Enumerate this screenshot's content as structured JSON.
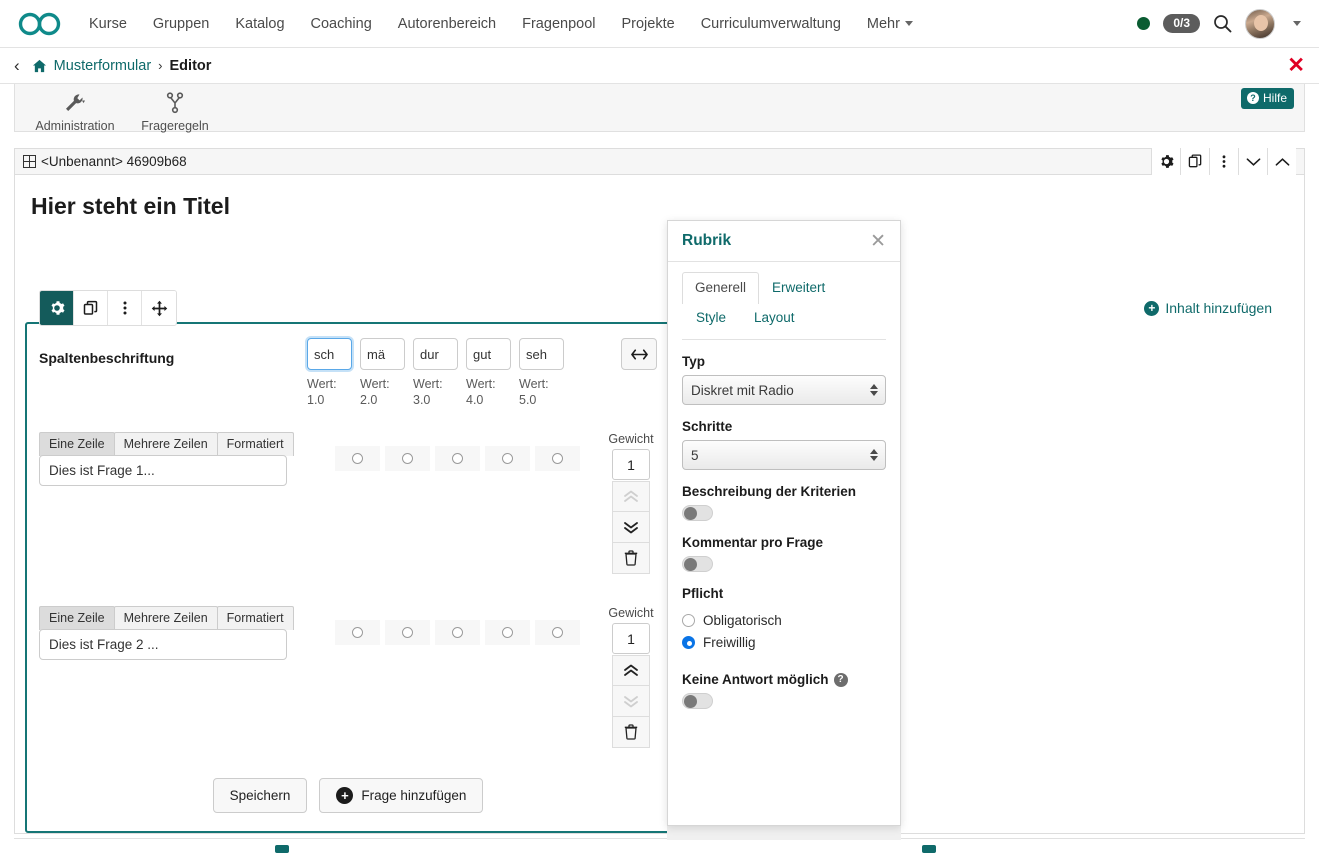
{
  "topnav": {
    "brand_icon": "infinity-logo",
    "links": [
      {
        "label": "Kurse"
      },
      {
        "label": "Gruppen"
      },
      {
        "label": "Katalog"
      },
      {
        "label": "Coaching"
      },
      {
        "label": "Autorenbereich"
      },
      {
        "label": "Fragenpool"
      },
      {
        "label": "Projekte"
      },
      {
        "label": "Curriculumverwaltung"
      },
      {
        "label": "Mehr"
      }
    ],
    "status_dot_color": "#0a5c32",
    "task_badge": "0/3",
    "search_icon": "search-icon",
    "avatar_caret": "chevron-down-icon"
  },
  "breadcrumb": {
    "back_icon": "chevron-left-icon",
    "home_icon": "home-icon",
    "root": "Musterformular",
    "separator": "›",
    "current": "Editor",
    "close": "✕"
  },
  "toolbar": {
    "items": [
      {
        "label": "Administration",
        "icon": "wrench-icon",
        "has_caret": true
      },
      {
        "label": "Frageregeln",
        "icon": "branch-icon",
        "has_caret": false
      }
    ],
    "help_label": "Hilfe",
    "help_icon": "question-circle-icon"
  },
  "block": {
    "header_title": "<Unbenannt> 46909b68",
    "header_icon": "table-icon",
    "header_actions": [
      {
        "name": "settings",
        "icon": "gear-icon"
      },
      {
        "name": "copy",
        "icon": "copy-icon"
      },
      {
        "name": "more",
        "icon": "kebab-icon"
      },
      {
        "name": "collapse",
        "icon": "chevron-down-icon"
      },
      {
        "name": "expand",
        "icon": "chevron-up-icon"
      }
    ],
    "page_title": "Hier steht ein Titel",
    "mini_toolbar": [
      {
        "name": "settings",
        "icon": "gear-icon",
        "active": true
      },
      {
        "name": "copy",
        "icon": "copy-icon",
        "active": false
      },
      {
        "name": "more",
        "icon": "kebab-icon",
        "active": false
      },
      {
        "name": "move",
        "icon": "move-icon",
        "active": false
      }
    ],
    "add_content_label": "Inhalt hinzufügen",
    "add_content_icon": "plus-circle-icon"
  },
  "rubric": {
    "column_label": "Spaltenbeschriftung",
    "columns": [
      {
        "text": "sch",
        "value_label": "Wert:",
        "value": "1.0",
        "focused": true
      },
      {
        "text": "mä",
        "value_label": "Wert:",
        "value": "2.0",
        "focused": false
      },
      {
        "text": "dur",
        "value_label": "Wert:",
        "value": "3.0",
        "focused": false
      },
      {
        "text": "gut",
        "value_label": "Wert:",
        "value": "4.0",
        "focused": false
      },
      {
        "text": "seh",
        "value_label": "Wert:",
        "value": "5.0",
        "focused": false
      }
    ],
    "resize_icon": "arrows-horizontal-icon",
    "format_tabs": [
      "Eine Zeile",
      "Mehrere Zeilen",
      "Formatiert"
    ],
    "weight_label": "Gewicht",
    "questions": [
      {
        "text": "Dies ist Frage 1...",
        "selected_tab": "Eine Zeile",
        "weight": "1",
        "up_enabled": false,
        "down_enabled": true,
        "radio_count": 5
      },
      {
        "text": "Dies ist Frage 2 ...",
        "selected_tab": "Eine Zeile",
        "weight": "1",
        "up_enabled": true,
        "down_enabled": false,
        "radio_count": 5
      }
    ],
    "move_up_icon": "chevrons-up-icon",
    "move_down_icon": "chevrons-down-icon",
    "delete_icon": "trash-icon",
    "save_label": "Speichern",
    "add_question_label": "Frage hinzufügen",
    "add_question_icon": "plus-circle-icon",
    "border_color": "#157575"
  },
  "panel": {
    "title": "Rubrik",
    "close_icon": "close-icon",
    "tabs_row1": [
      {
        "label": "Generell",
        "active": true
      },
      {
        "label": "Erweitert",
        "active": false
      }
    ],
    "tabs_row2": [
      {
        "label": "Style"
      },
      {
        "label": "Layout"
      }
    ],
    "fields": {
      "typ_label": "Typ",
      "typ_value": "Diskret mit Radio",
      "schritte_label": "Schritte",
      "schritte_value": "5",
      "kriterien_label": "Beschreibung der Kriterien",
      "kriterien_on": false,
      "kommentar_label": "Kommentar pro Frage",
      "kommentar_on": false,
      "pflicht_label": "Pflicht",
      "pflicht_options": [
        {
          "label": "Obligatorisch",
          "selected": false
        },
        {
          "label": "Freiwillig",
          "selected": true
        }
      ],
      "keine_antwort_label": "Keine Antwort möglich",
      "keine_antwort_help_icon": "question-circle-icon",
      "keine_antwort_on": false
    }
  },
  "colors": {
    "accent": "#0f6a6a",
    "rubric_border": "#157575",
    "radio_selected": "#0a74e6",
    "close_red": "#e00024"
  }
}
